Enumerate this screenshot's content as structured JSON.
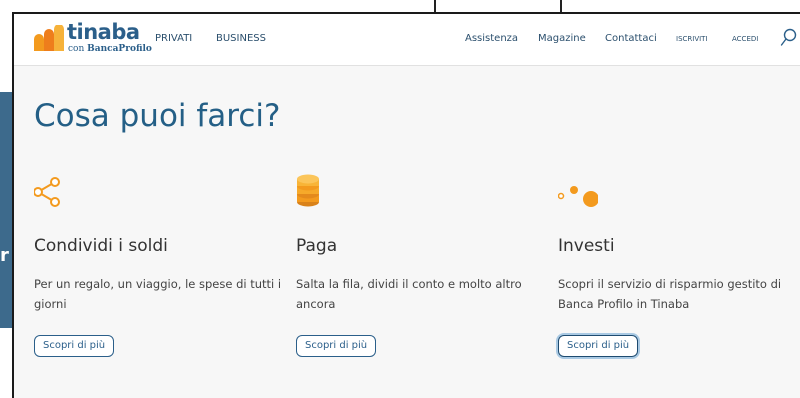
{
  "brand": {
    "name": "tinaba",
    "tagline_prefix": "con",
    "tagline_brand": "BancaProfilo"
  },
  "background": {
    "partial_letter": "r"
  },
  "nav": {
    "left": [
      "PRIVATI",
      "BUSINESS"
    ],
    "right": [
      "Assistenza",
      "Magazine",
      "Contattaci"
    ],
    "auth": [
      "ISCRIVITI",
      "ACCEDI"
    ]
  },
  "page": {
    "title": "Cosa puoi farci?"
  },
  "features": [
    {
      "title": "Condividi i soldi",
      "description": "Per un regalo, un viaggio, le spese di tutti i giorni",
      "cta": "Scopri di più",
      "icon": "share-icon"
    },
    {
      "title": "Paga",
      "description": "Salta la fila, dividi il conto e molto altro ancora",
      "cta": "Scopri di più",
      "icon": "coins-icon"
    },
    {
      "title": "Investi",
      "description": "Scopri il servizio di risparmio gestito di Banca Profilo in Tinaba",
      "cta": "Scopri di più",
      "icon": "growth-dots-icon"
    }
  ],
  "colors": {
    "brand_blue": "#2b5f8a",
    "title_blue": "#245f86",
    "accent_orange": "#f39a1e"
  }
}
